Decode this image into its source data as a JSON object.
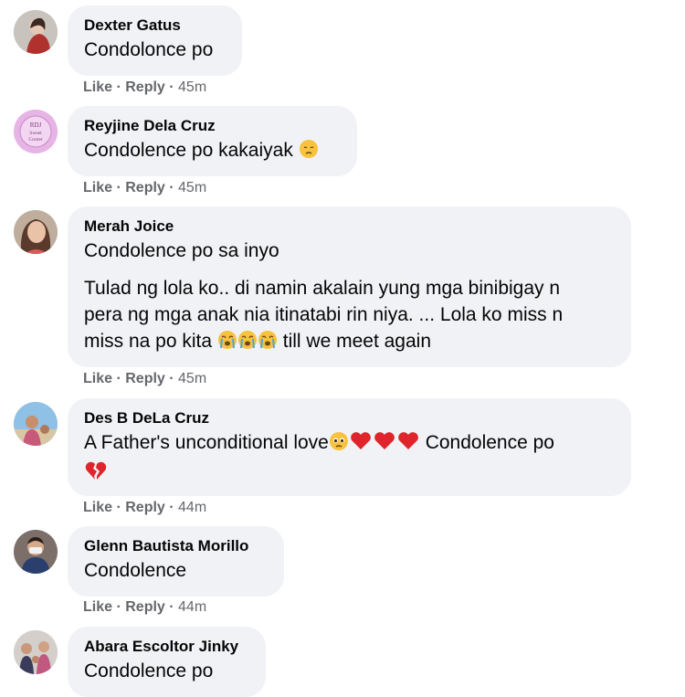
{
  "comments": [
    {
      "name": "Dexter Gatus",
      "text": "Condolonce po",
      "like": "Like",
      "reply": "Reply",
      "time": "45m"
    },
    {
      "name": "Reyjine Dela Cruz",
      "text": "Condolence po kakaiyak",
      "emoji": "pensive-face",
      "like": "Like",
      "reply": "Reply",
      "time": "45m",
      "avatar_text": "RDJ Sweet Corner"
    },
    {
      "name": "Merah Joice",
      "text": "Condolence po sa inyo",
      "text2a": "Tulad ng lola ko.. di namin akalain yung mga binibigay n",
      "text2b": "pera ng mga anak nia itinatabi rin niya. ... Lola ko miss n",
      "text2c_pre": "miss na po kita",
      "text2c_post": "till we meet again",
      "like": "Like",
      "reply": "Reply",
      "time": "45m"
    },
    {
      "name": "Des B DeLa Cruz",
      "text_pre": "A Father's unconditional love",
      "text_post": "Condolence po",
      "like": "Like",
      "reply": "Reply",
      "time": "44m"
    },
    {
      "name": "Glenn Bautista Morillo",
      "text": "Condolence",
      "like": "Like",
      "reply": "Reply",
      "time": "44m"
    },
    {
      "name": "Abara Escoltor Jinky",
      "text": "Condolence po"
    }
  ],
  "sep": " · "
}
